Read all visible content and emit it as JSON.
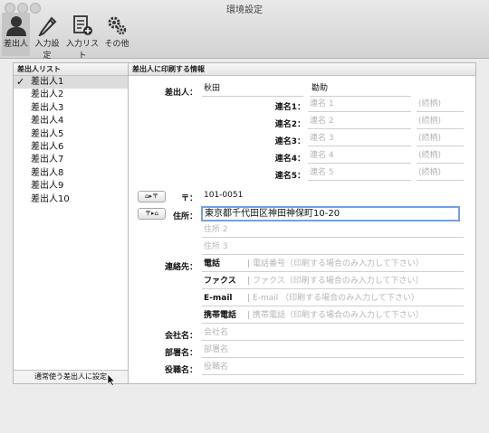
{
  "window": {
    "title": "環境設定"
  },
  "toolbar": {
    "items": [
      {
        "label": "差出人",
        "icon": "person-icon"
      },
      {
        "label": "入力設定",
        "icon": "pencil-icon"
      },
      {
        "label": "入力リスト",
        "icon": "list-add-icon"
      },
      {
        "label": "その他",
        "icon": "gears-icon"
      }
    ]
  },
  "sidebar": {
    "header": "差出人リスト",
    "items": [
      "差出人1",
      "差出人2",
      "差出人3",
      "差出人4",
      "差出人5",
      "差出人6",
      "差出人7",
      "差出人8",
      "差出人9",
      "差出人10"
    ],
    "selected_index": 0,
    "footer_button": "通常使う差出人に設定"
  },
  "form": {
    "header": "差出人に印刷する情報",
    "sender_label": "差出人：",
    "last_name": "秋田",
    "first_name": "勘助",
    "joint_names": [
      {
        "label": "連名1：",
        "placeholder": "連名 1",
        "honorific_placeholder": "(続柄)"
      },
      {
        "label": "連名2：",
        "placeholder": "連名 2",
        "honorific_placeholder": "(続柄)"
      },
      {
        "label": "連名3：",
        "placeholder": "連名 3",
        "honorific_placeholder": "(続柄)"
      },
      {
        "label": "連名4：",
        "placeholder": "連名 4",
        "honorific_placeholder": "(続柄)"
      },
      {
        "label": "連名5：",
        "placeholder": "連名 5",
        "honorific_placeholder": "(続柄)"
      }
    ],
    "postal_symbol": "〒：",
    "postal_code": "101-0051",
    "address_label": "住所：",
    "address1": "東京都千代田区神田神保町10-20",
    "address2_placeholder": "住所 2",
    "address3_placeholder": "住所 3",
    "contact_label": "連絡先：",
    "contacts": [
      {
        "type": "電話",
        "placeholder": "電話番号（印刷する場合のみ入力して下さい）"
      },
      {
        "type": "ファクス",
        "placeholder": "ファクス（印刷する場合のみ入力して下さい）"
      },
      {
        "type": "E-mail",
        "placeholder": "E-mail （印刷する場合のみ入力して下さい）"
      },
      {
        "type": "携帯電話",
        "placeholder": "携帯電話（印刷する場合のみ入力して下さい）"
      }
    ],
    "company_label": "会社名：",
    "company_placeholder": "会社名",
    "department_label": "部署名：",
    "department_placeholder": "部署名",
    "title_label": "役職名：",
    "title_placeholder": "役職名",
    "zip_to_address_button": "⌂▸〒",
    "address_to_zip_button": "〒▸⌂"
  }
}
